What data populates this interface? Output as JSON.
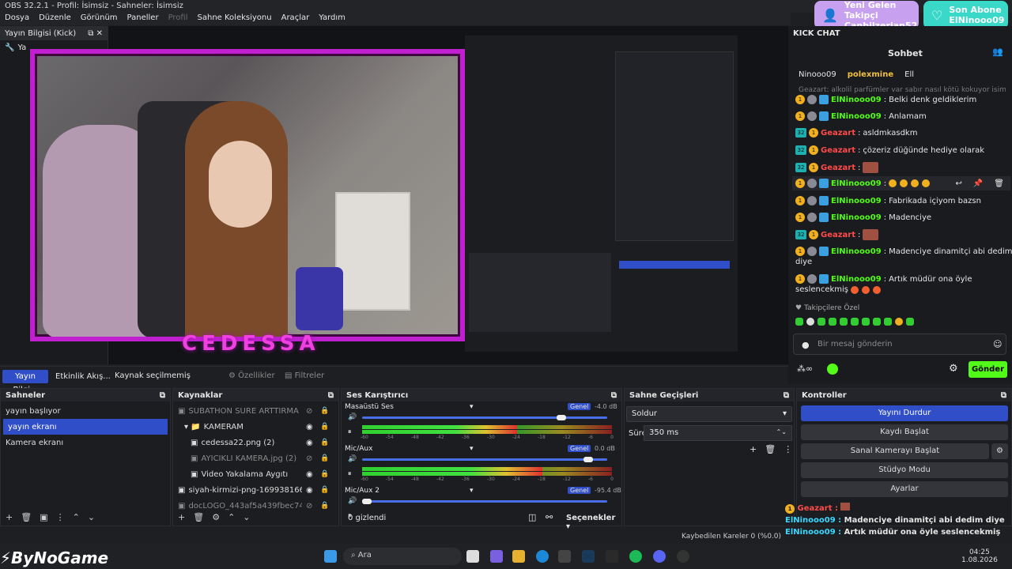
{
  "window": {
    "title": "OBS 32.2.1 - Profil: İsimsiz - Sahneler: İsimsiz"
  },
  "menu": [
    "Dosya",
    "Düzenle",
    "Görünüm",
    "Paneller",
    "Profil",
    "Sahne Koleksiyonu",
    "Araçlar",
    "Yardım"
  ],
  "left_dock": {
    "title": "Yayın Bilgisi (Kick)",
    "tab_partial": "Ya"
  },
  "stream_overlay": {
    "name": "CEDESSA"
  },
  "notifications": {
    "follower_title": "Yeni Gelen Takipçi",
    "follower_name": "Canbilzerian52",
    "sub_title": "Son Abone",
    "sub_name": "ElNinooo09"
  },
  "kick_chat": {
    "dock_title": "KICK CHAT",
    "tab_title": "Sohbet",
    "top_users": [
      {
        "name": "Ninooo09",
        "rank": "1"
      },
      {
        "name": "polexmine",
        "rank": "2"
      },
      {
        "name": "Ell",
        "rank": ""
      }
    ],
    "pinned_preview": "Geazart: alkolil parfümler var sabır nasıl kötü kokuyor isimli ku...",
    "messages": [
      {
        "user": "ElNinooo09",
        "text": "Belki denk geldiklerim",
        "color": "green"
      },
      {
        "user": "ElNinooo09",
        "text": "Anlamam",
        "color": "green"
      },
      {
        "user": "Geazart",
        "text": "asldmkasdkm",
        "color": "red"
      },
      {
        "user": "Geazart",
        "text": "çözeriz düğünde hediye olarak",
        "color": "red"
      },
      {
        "user": "Geazart",
        "text": "",
        "color": "red"
      },
      {
        "user": "ElNinooo09",
        "text": "",
        "color": "green"
      },
      {
        "user": "ElNinooo09",
        "text": "Fabrikada içiyom bazsn",
        "color": "green"
      },
      {
        "user": "ElNinooo09",
        "text": "Madenciye",
        "color": "green"
      },
      {
        "user": "Geazart",
        "text": "",
        "color": "red"
      },
      {
        "user": "ElNinooo09",
        "text": "Madenciye dinamitçi abi dedim",
        "color": "green"
      },
      {
        "user": "",
        "text": "diye",
        "color": "plain"
      },
      {
        "user": "ElNinooo09",
        "text": "Artık müdür ona öyle",
        "color": "green"
      },
      {
        "user": "",
        "text": "seslencekmiş",
        "color": "plain"
      }
    ],
    "followers_only": "Takipçilere Özel",
    "input_placeholder": "Bir mesaj gönderin",
    "send_label": "Gönder"
  },
  "source_bar": {
    "tab1": "Yayın Bilgi...",
    "tab2": "Etkinlik Akış...",
    "no_source": "Kaynak seçilmemiş",
    "properties": "Özellikler",
    "filters": "Filtreler"
  },
  "scenes": {
    "title": "Sahneler",
    "items": [
      "yayın başlıyor",
      "yayın ekranı",
      "Kamera ekranı"
    ],
    "selected": "yayın ekranı"
  },
  "sources": {
    "title": "Kaynaklar",
    "items": [
      {
        "label": "SUBATHON SÜRE ARTTIRMA",
        "dim": true
      },
      {
        "label": "KAMERAM",
        "dim": false
      },
      {
        "label": "cedessa22.png (2)",
        "dim": false
      },
      {
        "label": "AYICIKLI KAMERA.jpg (2)",
        "dim": true
      },
      {
        "label": "Video Yakalama Aygıtı",
        "dim": false
      },
      {
        "label": "siyah-kirmizi-png-1699381666070.pr",
        "dim": false
      },
      {
        "label": "docLOGO_443af5a439fbec74418f6a5",
        "dim": true
      }
    ]
  },
  "mixer": {
    "title": "Ses Karıştırıcı",
    "channels": [
      {
        "name": "Masaüstü Ses",
        "db": "-4.0 dB",
        "tag": "Genel",
        "level": 0.62
      },
      {
        "name": "Mic/Aux",
        "db": "0.0 dB",
        "tag": "Genel",
        "level": 0.72
      },
      {
        "name": "Mic/Aux 2",
        "db": "-95.4 dB",
        "tag": "Genel",
        "level": 0.0
      }
    ],
    "ticks": [
      "-60",
      "-54",
      "-48",
      "-42",
      "-36",
      "-30",
      "-24",
      "-18",
      "-12",
      "-6",
      "0"
    ],
    "hidden": "0 gizlendi",
    "options": "Seçenekler"
  },
  "transitions": {
    "title": "Sahne Geçişleri",
    "selected": "Soldur",
    "duration_label": "Süre",
    "duration": "350 ms"
  },
  "controls": {
    "title": "Kontroller",
    "buttons": [
      "Yayını Durdur",
      "Kaydı Başlat",
      "Sanal Kamerayı Başlat",
      "Stüdyo Modu",
      "Ayarlar"
    ]
  },
  "overlay_chat": [
    {
      "user": "Geazart :",
      "text": ""
    },
    {
      "user": "ElNinooo09 :",
      "text": "Madenciye dinamitçi abi dedim diye"
    },
    {
      "user": "ElNinooo09 :",
      "text": "Artık müdür ona öyle seslencekmiş"
    }
  ],
  "status": {
    "dropped": "Kaybedilen Kareler 0 (%0.0)"
  },
  "taskbar": {
    "search": "Ara",
    "time": "04:25",
    "date": "1.08.2026"
  },
  "watermark": "ByNoGame"
}
